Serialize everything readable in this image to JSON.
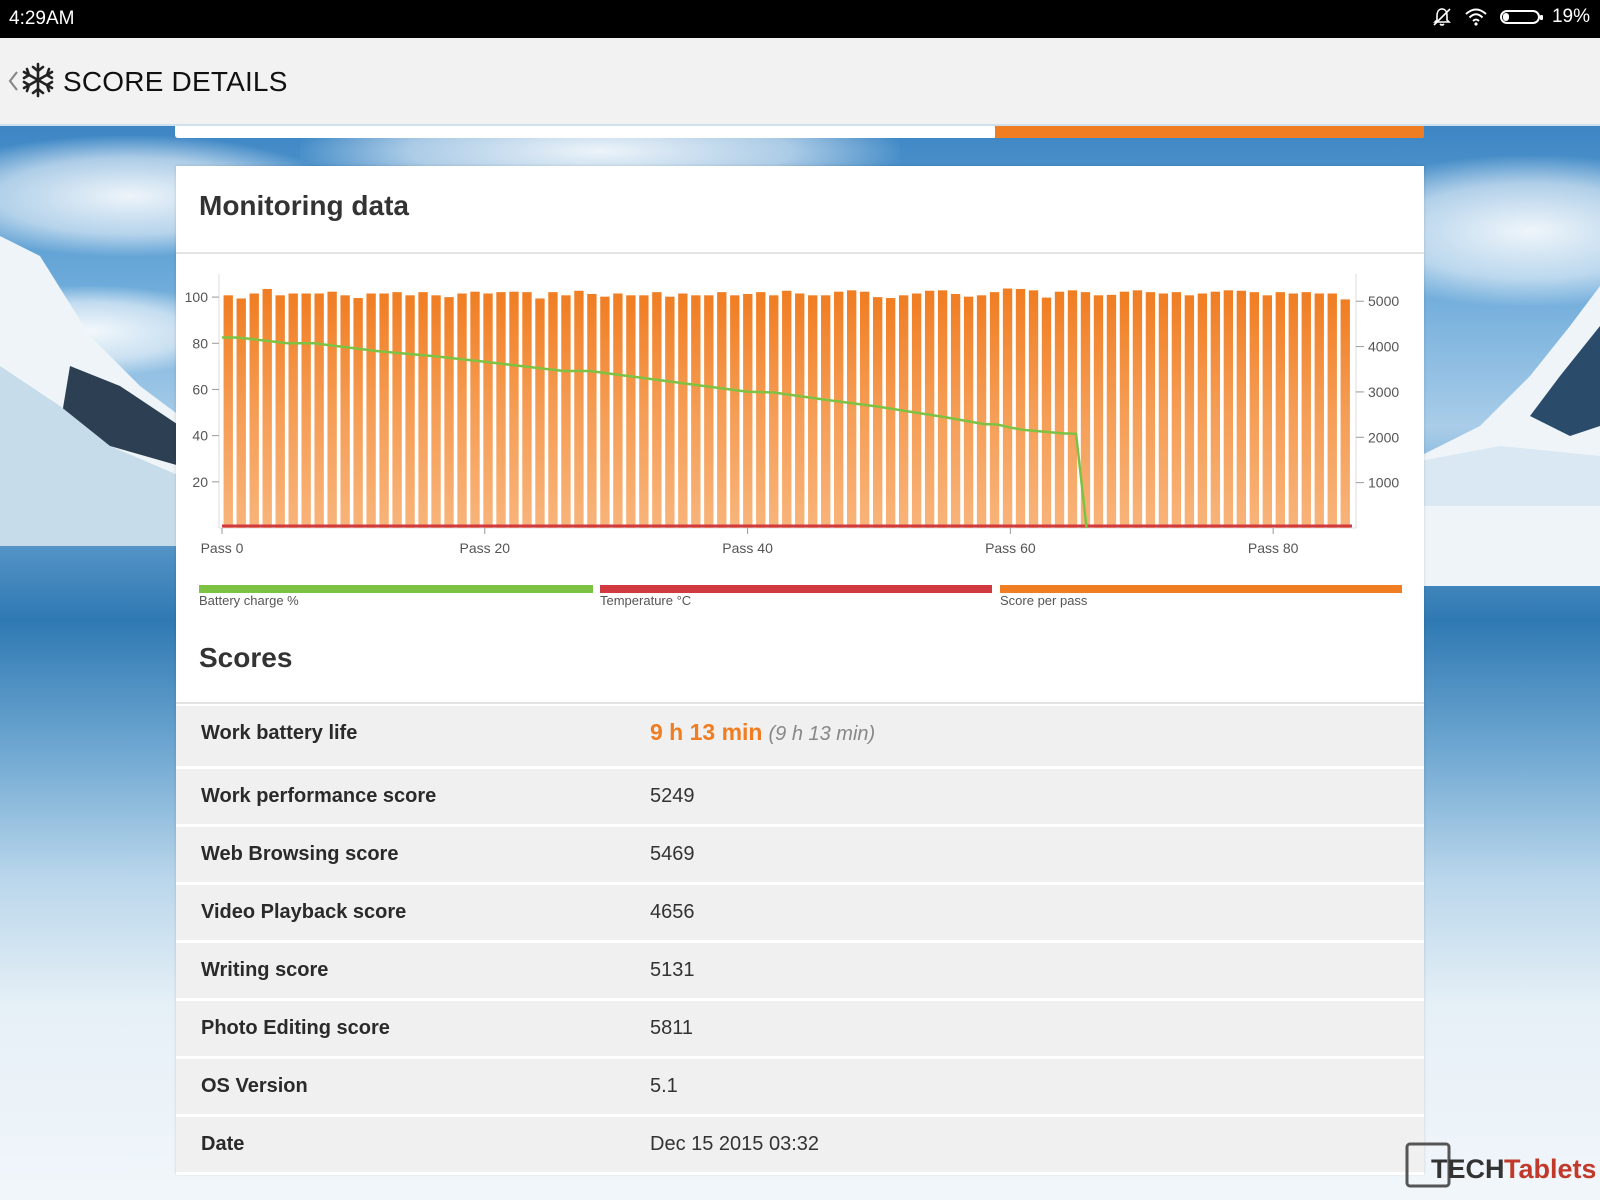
{
  "status_bar": {
    "time": "4:29AM",
    "battery_text": "19%",
    "battery_level": 0.19
  },
  "header": {
    "title": "SCORE DETAILS"
  },
  "monitoring": {
    "title": "Monitoring data",
    "legend": [
      {
        "label": "Battery charge %",
        "color": "#7dc242"
      },
      {
        "label": "Temperature °C",
        "color": "#d0393f"
      },
      {
        "label": "Score per pass",
        "color": "#f07d22"
      }
    ]
  },
  "chart_data": {
    "type": "bar",
    "x_tick_labels": [
      "Pass 0",
      "Pass 20",
      "Pass 40",
      "Pass 60",
      "Pass 80"
    ],
    "x_tick_values": [
      0,
      20,
      40,
      60,
      80
    ],
    "x_range": [
      0,
      86
    ],
    "y_left_ticks": [
      20,
      40,
      60,
      80,
      100
    ],
    "y_left_range": [
      0,
      110
    ],
    "y_right_ticks": [
      1000,
      2000,
      3000,
      4000,
      5000
    ],
    "y_right_range": [
      0,
      5600
    ],
    "series": [
      {
        "name": "Score per pass",
        "axis": "right",
        "type": "bar",
        "values": [
          5130,
          5060,
          5170,
          5270,
          5130,
          5170,
          5170,
          5170,
          5210,
          5130,
          5070,
          5170,
          5170,
          5200,
          5130,
          5200,
          5130,
          5090,
          5170,
          5210,
          5170,
          5200,
          5210,
          5200,
          5060,
          5200,
          5130,
          5230,
          5160,
          5100,
          5170,
          5130,
          5130,
          5200,
          5100,
          5170,
          5130,
          5130,
          5200,
          5130,
          5160,
          5200,
          5130,
          5230,
          5170,
          5130,
          5130,
          5210,
          5240,
          5210,
          5090,
          5070,
          5130,
          5170,
          5230,
          5240,
          5160,
          5100,
          5130,
          5200,
          5280,
          5270,
          5240,
          5080,
          5210,
          5240,
          5200,
          5130,
          5140,
          5210,
          5240,
          5200,
          5170,
          5200,
          5130,
          5170,
          5210,
          5240,
          5230,
          5200,
          5130,
          5200,
          5170,
          5200,
          5170,
          5170,
          5040
        ]
      },
      {
        "name": "Battery charge %",
        "axis": "left",
        "type": "line",
        "x": [
          0,
          1,
          2,
          5,
          7,
          12,
          16,
          20,
          26,
          28,
          32,
          40,
          42,
          46,
          50,
          55,
          58,
          59,
          60,
          61,
          64,
          65,
          65.8
        ],
        "values": [
          82.5,
          82.5,
          82,
          80,
          80,
          76.5,
          74.5,
          72,
          68,
          68,
          65,
          59,
          58.7,
          55.5,
          52.5,
          48,
          45,
          44.8,
          43.5,
          42.5,
          41,
          40.8,
          0
        ]
      },
      {
        "name": "Temperature °C",
        "axis": "left",
        "type": "line",
        "x": [
          0,
          86
        ],
        "values": [
          0,
          0
        ]
      }
    ]
  },
  "scores": {
    "title": "Scores",
    "rows": [
      {
        "label": "Work battery life",
        "value": "9 h 13 min",
        "sub": "(9 h 13 min)"
      },
      {
        "label": "Work performance score",
        "value": "5249"
      },
      {
        "label": "Web Browsing score",
        "value": "5469"
      },
      {
        "label": "Video Playback score",
        "value": "4656"
      },
      {
        "label": "Writing score",
        "value": "5131"
      },
      {
        "label": "Photo Editing score",
        "value": "5811"
      },
      {
        "label": "OS Version",
        "value": "5.1"
      },
      {
        "label": "Date",
        "value": "Dec 15 2015 03:32"
      }
    ]
  },
  "watermark": {
    "part1": "TECH",
    "part2": "Tablets"
  }
}
